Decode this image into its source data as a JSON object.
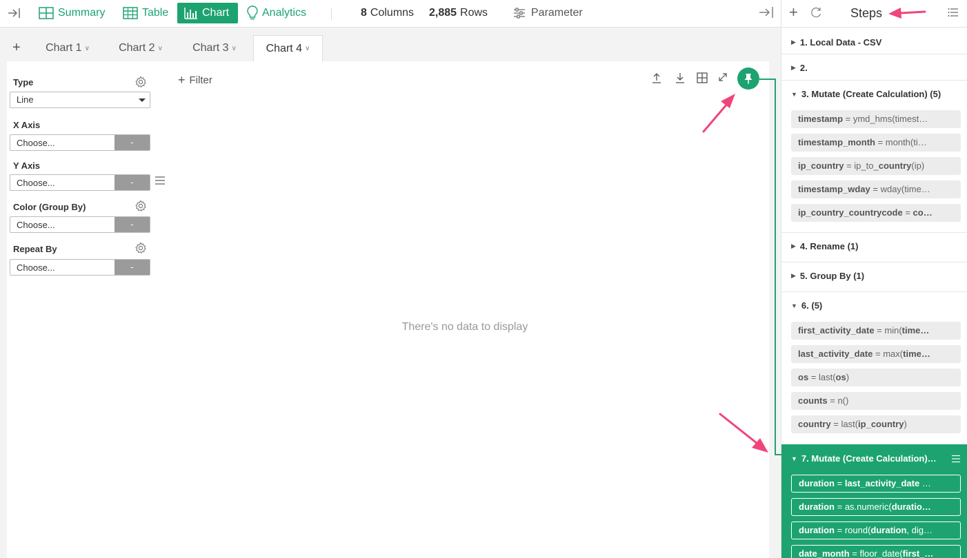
{
  "toolbar": {
    "tabs": [
      {
        "label": "Summary",
        "icon": "summary-grid-icon"
      },
      {
        "label": "Table",
        "icon": "table-icon"
      },
      {
        "label": "Chart",
        "icon": "bar-chart-icon",
        "active": true
      },
      {
        "label": "Analytics",
        "icon": "lightbulb-icon"
      }
    ],
    "columns_count": "8",
    "columns_label": "Columns",
    "rows_count": "2,885",
    "rows_label": "Rows",
    "parameter_label": "Parameter"
  },
  "chart_tabs": [
    {
      "label": "Chart 1"
    },
    {
      "label": "Chart 2"
    },
    {
      "label": "Chart 3"
    },
    {
      "label": "Chart 4",
      "active": true
    }
  ],
  "config": {
    "type_label": "Type",
    "type_value": "Line",
    "x_axis_label": "X Axis",
    "y_axis_label": "Y Axis",
    "color_label": "Color (Group By)",
    "repeat_label": "Repeat By",
    "choose_placeholder": "Choose...",
    "dash_button": "-"
  },
  "filter_label": "Filter",
  "empty_message": "There's no data to display",
  "steps_panel": {
    "title": "Steps",
    "steps": [
      {
        "label": "1. Local Data - CSV"
      },
      {
        "label": "2."
      },
      {
        "label": "3. Mutate (Create Calculation) (5)",
        "expanded": true,
        "items": [
          {
            "name": "timestamp",
            "expr": " = ymd_hms(timest…"
          },
          {
            "name": "timestamp_month",
            "expr": " = month(ti…"
          },
          {
            "name": "ip_country",
            "expr": " = ip_to_",
            "expr_bold": "country",
            "expr_tail": "(ip)"
          },
          {
            "name": "timestamp_wday",
            "expr": " = wday(time…"
          },
          {
            "name": "ip_country_countrycode",
            "expr": " = ",
            "expr_bold": "co…",
            "expr_tail": ""
          }
        ]
      },
      {
        "label": "4. Rename (1)"
      },
      {
        "label": "5. Group By (1)"
      },
      {
        "label": "6. (5)",
        "expanded": true,
        "items": [
          {
            "name": "first_activity_date",
            "expr": " = min(",
            "expr_bold": "time…",
            "expr_tail": ""
          },
          {
            "name": "last_activity_date",
            "expr": " = max(",
            "expr_bold": "time…",
            "expr_tail": ""
          },
          {
            "name": "os",
            "expr": " = last(",
            "expr_bold": "os",
            "expr_tail": ")"
          },
          {
            "name": "counts",
            "expr": " = n()",
            "expr_bold": "",
            "expr_tail": ""
          },
          {
            "name": "country",
            "expr": " = last(",
            "expr_bold": "ip_country",
            "expr_tail": ")"
          }
        ]
      },
      {
        "label": "7. Mutate (Create Calculation)…",
        "active": true,
        "items": [
          {
            "name": "duration",
            "expr": " = ",
            "expr_bold": "last_activity_date",
            "expr_tail": " …"
          },
          {
            "name": "duration",
            "expr": " = as.numeric(",
            "expr_bold": "duratio…",
            "expr_tail": ""
          },
          {
            "name": "duration",
            "expr": " = round(",
            "expr_bold": "duration",
            "expr_tail": ", dig…"
          },
          {
            "name": "date_month",
            "expr": " = floor_date(",
            "expr_bold": "first_…",
            "expr_tail": ""
          }
        ]
      }
    ]
  },
  "colors": {
    "accent": "#1da370",
    "annotation_arrow": "#f0457a"
  }
}
